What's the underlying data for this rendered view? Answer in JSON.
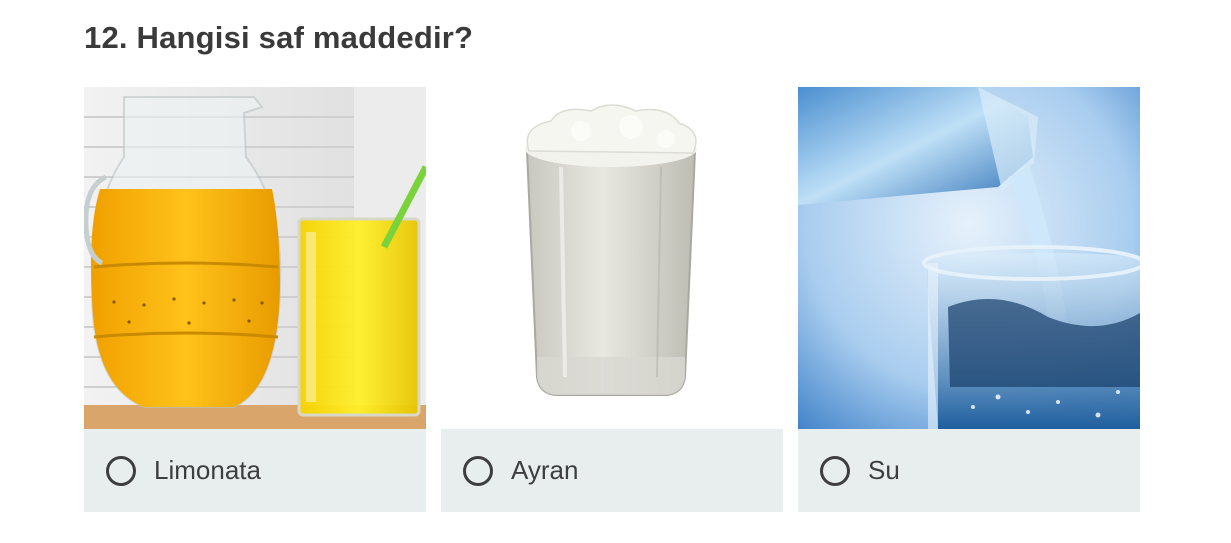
{
  "question": {
    "title": "12. Hangisi saf maddedir?"
  },
  "options": [
    {
      "label": "Limonata",
      "image": "lemonade-pitcher-and-glass",
      "selected": false
    },
    {
      "label": "Ayran",
      "image": "ayran-glass",
      "selected": false
    },
    {
      "label": "Su",
      "image": "water-pouring-into-glass",
      "selected": false
    }
  ],
  "colors": {
    "footer_bg": "#e8eeee",
    "title": "#3a3a3a",
    "radio_border": "#3e3e3e",
    "lemonade": "#f5b400",
    "water_blue": "#2d7fc4"
  }
}
